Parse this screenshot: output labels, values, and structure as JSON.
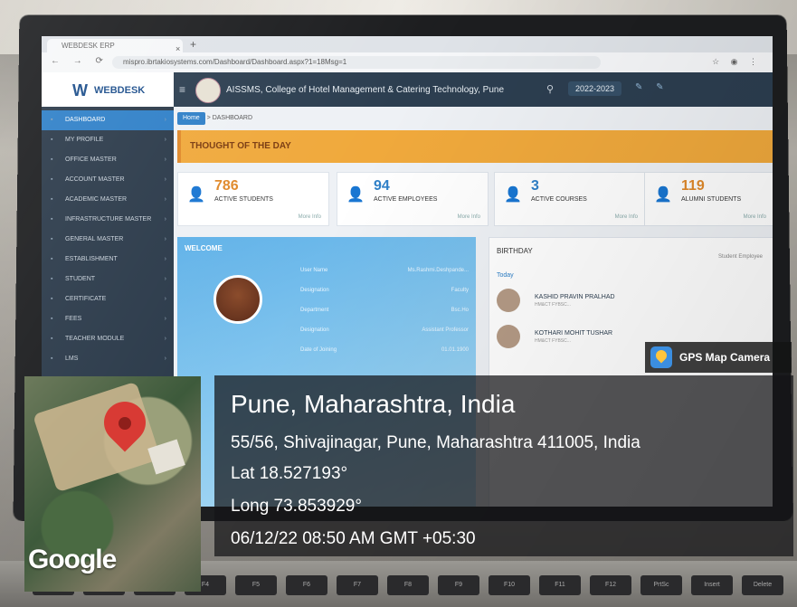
{
  "browser": {
    "tab_title": "WEBDESK ERP",
    "url": "mispro.ibrtakiosystems.com/Dashboard/Dashboard.aspx?1=18Msg=1"
  },
  "header": {
    "brand": "WEBDESK",
    "college": "AISSMS, College of Hotel Management & Catering Technology, Pune",
    "academic_year": "2022-2023"
  },
  "sidebar": {
    "items": [
      {
        "label": "DASHBOARD",
        "active": true
      },
      {
        "label": "MY PROFILE"
      },
      {
        "label": "OFFICE MASTER"
      },
      {
        "label": "ACCOUNT MASTER"
      },
      {
        "label": "ACADEMIC MASTER"
      },
      {
        "label": "INFRASTRUCTURE MASTER"
      },
      {
        "label": "GENERAL MASTER"
      },
      {
        "label": "ESTABLISHMENT"
      },
      {
        "label": "STUDENT"
      },
      {
        "label": "CERTIFICATE"
      },
      {
        "label": "FEES"
      },
      {
        "label": "TEACHER MODULE"
      },
      {
        "label": "LMS"
      }
    ]
  },
  "breadcrumb": {
    "home": "Home",
    "current": "DASHBOARD"
  },
  "thought": {
    "title": "THOUGHT OF THE DAY"
  },
  "cards": [
    {
      "value": "786",
      "label": "ACTIVE STUDENTS",
      "more": "More Info",
      "color": "#e0892a"
    },
    {
      "value": "94",
      "label": "ACTIVE EMPLOYEES",
      "more": "More Info",
      "color": "#2f80c8"
    },
    {
      "value": "3",
      "label": "ACTIVE COURSES",
      "more": "More Info",
      "color": "#2f80c8"
    },
    {
      "value": "119",
      "label": "ALUMNI STUDENTS",
      "more": "More Info",
      "color": "#e0892a"
    }
  ],
  "welcome": {
    "title": "WELCOME",
    "rows": [
      {
        "k": "User Name",
        "v": "Ms.Rashmi.Deshpande..."
      },
      {
        "k": "Designation",
        "v": "Faculty"
      },
      {
        "k": "Department",
        "v": "Bsc.Ho"
      },
      {
        "k": "Designation",
        "v": "Assistant Professor"
      },
      {
        "k": "Date of Joining",
        "v": "01.01.1900"
      }
    ]
  },
  "birthday": {
    "title": "BIRTHDAY",
    "filter": "Student  Employee",
    "today": "Today",
    "people": [
      {
        "name": "KASHID PRAVIN PRALHAD",
        "sub": "HM&CT FYBSC..."
      },
      {
        "name": "KOTHARI MOHIT TUSHAR",
        "sub": "HM&CT FYBSC..."
      }
    ]
  },
  "gps": {
    "app": "GPS Map Camera",
    "title": "Pune, Maharashtra, India",
    "address": "55/56, Shivajinagar, Pune, Maharashtra 411005, India",
    "lat": "Lat 18.527193°",
    "long": "Long 73.853929°",
    "datetime": "06/12/22 08:50 AM GMT +05:30",
    "map_brand": "Google"
  },
  "keyboard": {
    "keys": [
      "F1",
      "F2",
      "F3",
      "F4",
      "F5",
      "F6",
      "F7",
      "F8",
      "F9",
      "F10",
      "F11",
      "F12",
      "PrtSc",
      "Insert",
      "Delete"
    ]
  }
}
